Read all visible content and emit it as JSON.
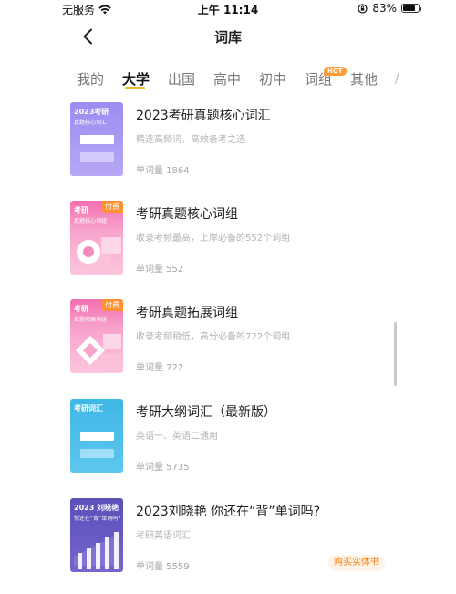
{
  "status_bar": {
    "carrier": "无服务",
    "time": "上午 11:14",
    "battery": "83%",
    "battery_level": 0.83
  },
  "nav": {
    "title": "词库"
  },
  "tabs": [
    {
      "label": "我的"
    },
    {
      "label": "大学"
    },
    {
      "label": "出国"
    },
    {
      "label": "高中"
    },
    {
      "label": "初中"
    },
    {
      "label": "词组",
      "badge": "HOT"
    },
    {
      "label": "其他"
    }
  ],
  "books": [
    {
      "cover_line1": "2023考研",
      "cover_line2": "真题核心词汇",
      "title": "2023考研真题核心词汇",
      "desc": "精选高频词，高效备考之选",
      "count": "单词量 1864",
      "paid": ""
    },
    {
      "cover_line1": "考研",
      "cover_line2": "真题核心词组",
      "title": "考研真题核心词组",
      "desc": "收录考频最高，上岸必备的552个词组",
      "count": "单词量 552",
      "paid": "付费"
    },
    {
      "cover_line1": "考研",
      "cover_line2": "真题拓展词组",
      "title": "考研真题拓展词组",
      "desc": "收录考频稍低，高分必备的722个词组",
      "count": "单词量 722",
      "paid": "付费"
    },
    {
      "cover_line1": "考研词汇",
      "cover_line2": "",
      "title": "考研大纲词汇（最新版）",
      "desc": "英语一、英语二通用",
      "count": "单词量 5735",
      "paid": ""
    },
    {
      "cover_line1": "2023 刘晓艳",
      "cover_line2": "你还在“背”单词吗?",
      "title": "2023刘晓艳 你还在“背”单词吗?",
      "desc": "考研英语词汇",
      "count": "单词量 5559",
      "paid": ""
    }
  ],
  "buy_button": "购买实体书",
  "colors": {
    "accent": "#f7b52b",
    "paid": "#ff9133",
    "buy_text": "#ff7a00"
  }
}
